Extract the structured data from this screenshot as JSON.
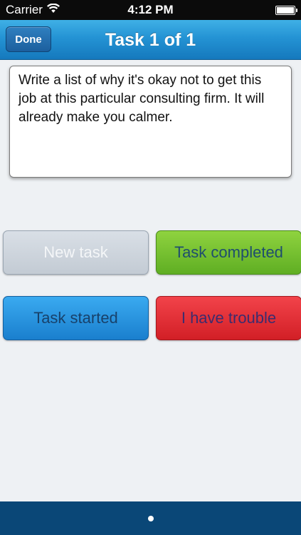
{
  "status_bar": {
    "carrier": "Carrier",
    "time": "4:12 PM",
    "icons": [
      "wifi-icon",
      "battery-icon"
    ]
  },
  "nav": {
    "done_label": "Done",
    "title": "Task 1 of 1"
  },
  "task": {
    "text": "Write a list of why it's okay not to get this job at this particular consulting firm. It will already make you calmer."
  },
  "buttons": {
    "new_task": "New task",
    "task_completed": "Task completed",
    "task_started": "Task started",
    "trouble": "I have trouble"
  },
  "colors": {
    "nav_blue": "#2493d4",
    "bottom_bar": "#0a4777",
    "new_task_gray": "#c3cbd4",
    "completed_green": "#6cbf2b",
    "started_blue": "#1f8bdb",
    "trouble_red": "#e0282f"
  },
  "pager": {
    "current": 1,
    "total": 1
  }
}
